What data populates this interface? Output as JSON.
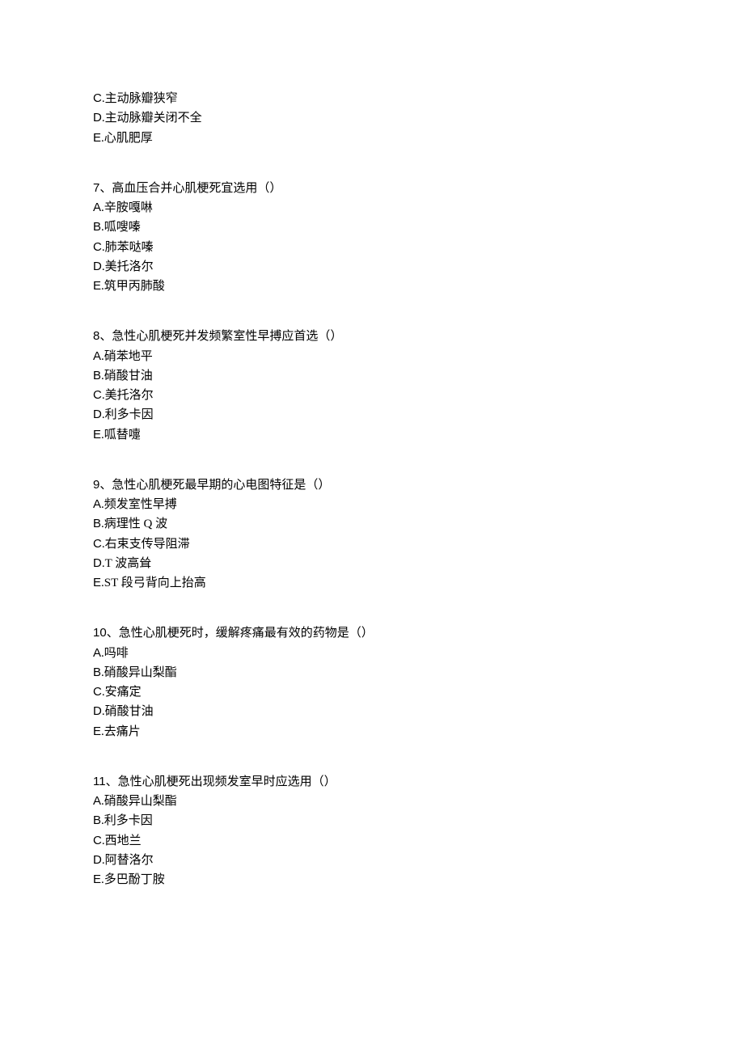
{
  "blocks": [
    {
      "type": "options-only",
      "options": [
        {
          "letter": "C",
          "text": ".主动脉瓣狭窄"
        },
        {
          "letter": "D",
          "text": ".主动脉瓣关闭不全"
        },
        {
          "letter": "E",
          "text": ".心肌肥厚"
        }
      ]
    },
    {
      "type": "question",
      "number": "7",
      "stem": "、高血压合并心肌梗死宜选用（）",
      "options": [
        {
          "letter": "A",
          "text": ".辛胺嘎啉"
        },
        {
          "letter": "B",
          "text": ".呱嗖嗪"
        },
        {
          "letter": "C",
          "text": ".肺苯哒嗪"
        },
        {
          "letter": "D",
          "text": ".美托洛尔"
        },
        {
          "letter": "E",
          "text": ".筑甲丙肺酸"
        }
      ]
    },
    {
      "type": "question",
      "number": "8",
      "stem": "、急性心肌梗死并发频繁室性早搏应首选（）",
      "options": [
        {
          "letter": "A",
          "text": ".硝苯地平"
        },
        {
          "letter": "B",
          "text": ".硝酸甘油"
        },
        {
          "letter": "C",
          "text": ".美托洛尔"
        },
        {
          "letter": "D",
          "text": ".利多卡因"
        },
        {
          "letter": "E",
          "text": ".呱替嚏"
        }
      ]
    },
    {
      "type": "question",
      "number": "9",
      "stem": "、急性心肌梗死最早期的心电图特征是（）",
      "options": [
        {
          "letter": "A",
          "text": ".频发室性早搏"
        },
        {
          "letter": "B",
          "text": ".病理性 Q 波"
        },
        {
          "letter": "C",
          "text": ".右束支传导阻滞"
        },
        {
          "letter": "D",
          "text": ".T 波高耸"
        },
        {
          "letter": "E",
          "text": ".ST 段弓背向上抬高"
        }
      ]
    },
    {
      "type": "question",
      "number": "10",
      "stem": "、急性心肌梗死时，缓解疼痛最有效的药物是（）",
      "options": [
        {
          "letter": "A",
          "text": ".吗啡"
        },
        {
          "letter": "B",
          "text": ".硝酸异山梨酯"
        },
        {
          "letter": "C",
          "text": ".安痛定"
        },
        {
          "letter": "D",
          "text": ".硝酸甘油"
        },
        {
          "letter": "E",
          "text": ".去痛片"
        }
      ]
    },
    {
      "type": "question",
      "number": "11",
      "stem": "、急性心肌梗死出现频发室早时应选用（）",
      "options": [
        {
          "letter": "A",
          "text": ".硝酸异山梨酯"
        },
        {
          "letter": "B",
          "text": ".利多卡因"
        },
        {
          "letter": "C",
          "text": ".西地兰"
        },
        {
          "letter": "D",
          "text": ".阿替洛尔"
        },
        {
          "letter": "E",
          "text": ".多巴酚丁胺"
        }
      ]
    }
  ]
}
